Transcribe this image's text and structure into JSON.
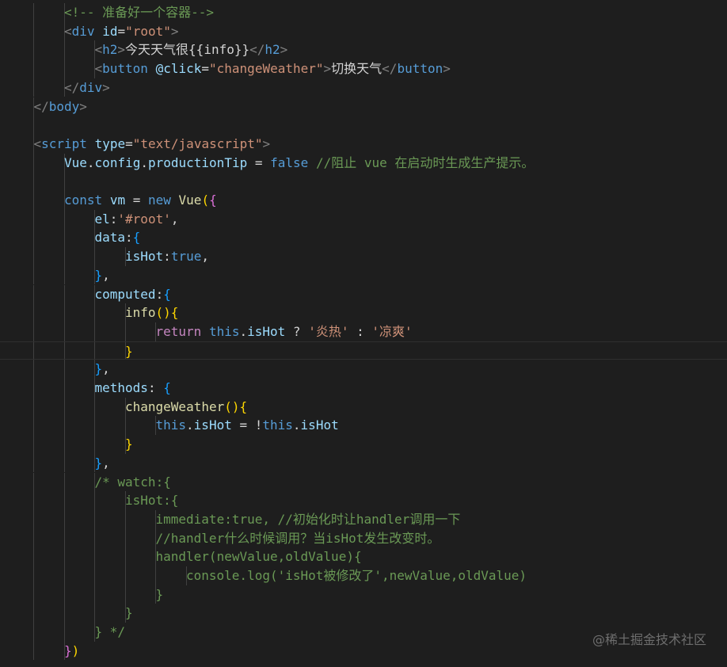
{
  "lines": [
    {
      "indent": 2,
      "guides": 2,
      "tokens": [
        {
          "c": "cmt",
          "t": "<!-- 准备好一个容器-->"
        }
      ]
    },
    {
      "indent": 2,
      "guides": 2,
      "tokens": [
        {
          "c": "punct",
          "t": "<"
        },
        {
          "c": "tag",
          "t": "div"
        },
        {
          "c": "text",
          "t": " "
        },
        {
          "c": "attr",
          "t": "id"
        },
        {
          "c": "text",
          "t": "="
        },
        {
          "c": "str",
          "t": "\"root\""
        },
        {
          "c": "punct",
          "t": ">"
        }
      ]
    },
    {
      "indent": 3,
      "guides": 3,
      "tokens": [
        {
          "c": "punct",
          "t": "<"
        },
        {
          "c": "tag",
          "t": "h2"
        },
        {
          "c": "punct",
          "t": ">"
        },
        {
          "c": "text",
          "t": "今天天气很{{info}}"
        },
        {
          "c": "punct",
          "t": "</"
        },
        {
          "c": "tag",
          "t": "h2"
        },
        {
          "c": "punct",
          "t": ">"
        }
      ]
    },
    {
      "indent": 3,
      "guides": 3,
      "tokens": [
        {
          "c": "punct",
          "t": "<"
        },
        {
          "c": "tag",
          "t": "button"
        },
        {
          "c": "text",
          "t": " "
        },
        {
          "c": "attr",
          "t": "@click"
        },
        {
          "c": "text",
          "t": "="
        },
        {
          "c": "str",
          "t": "\"changeWeather\""
        },
        {
          "c": "punct",
          "t": ">"
        },
        {
          "c": "text",
          "t": "切换天气"
        },
        {
          "c": "punct",
          "t": "</"
        },
        {
          "c": "tag",
          "t": "button"
        },
        {
          "c": "punct",
          "t": ">"
        }
      ]
    },
    {
      "indent": 2,
      "guides": 2,
      "tokens": [
        {
          "c": "punct",
          "t": "</"
        },
        {
          "c": "tag",
          "t": "div"
        },
        {
          "c": "punct",
          "t": ">"
        }
      ]
    },
    {
      "indent": 1,
      "guides": 1,
      "tokens": [
        {
          "c": "punct",
          "t": "</"
        },
        {
          "c": "tag",
          "t": "body"
        },
        {
          "c": "punct",
          "t": ">"
        }
      ]
    },
    {
      "indent": 0,
      "guides": 1,
      "tokens": []
    },
    {
      "indent": 1,
      "guides": 1,
      "tokens": [
        {
          "c": "punct",
          "t": "<"
        },
        {
          "c": "tag",
          "t": "script"
        },
        {
          "c": "text",
          "t": " "
        },
        {
          "c": "attr",
          "t": "type"
        },
        {
          "c": "text",
          "t": "="
        },
        {
          "c": "str",
          "t": "\"text/javascript\""
        },
        {
          "c": "punct",
          "t": ">"
        }
      ]
    },
    {
      "indent": 2,
      "guides": 2,
      "tokens": [
        {
          "c": "attr",
          "t": "Vue"
        },
        {
          "c": "text",
          "t": "."
        },
        {
          "c": "attr",
          "t": "config"
        },
        {
          "c": "text",
          "t": "."
        },
        {
          "c": "attr",
          "t": "productionTip"
        },
        {
          "c": "text",
          "t": " = "
        },
        {
          "c": "bool",
          "t": "false"
        },
        {
          "c": "text",
          "t": " "
        },
        {
          "c": "cmt",
          "t": "//阻止 vue 在启动时生成生产提示。"
        }
      ]
    },
    {
      "indent": 0,
      "guides": 2,
      "tokens": []
    },
    {
      "indent": 2,
      "guides": 2,
      "tokens": [
        {
          "c": "kw",
          "t": "const"
        },
        {
          "c": "text",
          "t": " "
        },
        {
          "c": "attr",
          "t": "vm"
        },
        {
          "c": "text",
          "t": " = "
        },
        {
          "c": "kw",
          "t": "new"
        },
        {
          "c": "text",
          "t": " "
        },
        {
          "c": "fn",
          "t": "Vue"
        },
        {
          "c": "b1",
          "t": "("
        },
        {
          "c": "b2",
          "t": "{"
        }
      ]
    },
    {
      "indent": 3,
      "guides": 3,
      "tokens": [
        {
          "c": "attr",
          "t": "el"
        },
        {
          "c": "text",
          "t": ":"
        },
        {
          "c": "str",
          "t": "'#root'"
        },
        {
          "c": "text",
          "t": ","
        }
      ]
    },
    {
      "indent": 3,
      "guides": 3,
      "tokens": [
        {
          "c": "attr",
          "t": "data"
        },
        {
          "c": "text",
          "t": ":"
        },
        {
          "c": "b3",
          "t": "{"
        }
      ]
    },
    {
      "indent": 4,
      "guides": 4,
      "tokens": [
        {
          "c": "attr",
          "t": "isHot"
        },
        {
          "c": "text",
          "t": ":"
        },
        {
          "c": "bool",
          "t": "true"
        },
        {
          "c": "text",
          "t": ","
        }
      ]
    },
    {
      "indent": 3,
      "guides": 3,
      "tokens": [
        {
          "c": "b3",
          "t": "}"
        },
        {
          "c": "text",
          "t": ","
        }
      ]
    },
    {
      "indent": 3,
      "guides": 3,
      "tokens": [
        {
          "c": "attr",
          "t": "computed"
        },
        {
          "c": "text",
          "t": ":"
        },
        {
          "c": "b3",
          "t": "{"
        }
      ]
    },
    {
      "indent": 4,
      "guides": 4,
      "tokens": [
        {
          "c": "fn",
          "t": "info"
        },
        {
          "c": "b1",
          "t": "()"
        },
        {
          "c": "b1",
          "t": "{"
        }
      ]
    },
    {
      "indent": 5,
      "guides": 5,
      "tokens": [
        {
          "c": "ctl",
          "t": "return"
        },
        {
          "c": "text",
          "t": " "
        },
        {
          "c": "kw",
          "t": "this"
        },
        {
          "c": "text",
          "t": "."
        },
        {
          "c": "attr",
          "t": "isHot"
        },
        {
          "c": "text",
          "t": " ? "
        },
        {
          "c": "str",
          "t": "'炎热'"
        },
        {
          "c": "text",
          "t": " : "
        },
        {
          "c": "str",
          "t": "'凉爽'"
        }
      ]
    },
    {
      "indent": 4,
      "guides": 4,
      "current": true,
      "tokens": [
        {
          "c": "b1",
          "t": "}"
        }
      ]
    },
    {
      "indent": 3,
      "guides": 3,
      "tokens": [
        {
          "c": "b3",
          "t": "}"
        },
        {
          "c": "text",
          "t": ","
        }
      ]
    },
    {
      "indent": 3,
      "guides": 3,
      "tokens": [
        {
          "c": "attr",
          "t": "methods"
        },
        {
          "c": "text",
          "t": ": "
        },
        {
          "c": "b3",
          "t": "{"
        }
      ]
    },
    {
      "indent": 4,
      "guides": 4,
      "tokens": [
        {
          "c": "fn",
          "t": "changeWeather"
        },
        {
          "c": "b1",
          "t": "()"
        },
        {
          "c": "b1",
          "t": "{"
        }
      ]
    },
    {
      "indent": 5,
      "guides": 5,
      "tokens": [
        {
          "c": "kw",
          "t": "this"
        },
        {
          "c": "text",
          "t": "."
        },
        {
          "c": "attr",
          "t": "isHot"
        },
        {
          "c": "text",
          "t": " = !"
        },
        {
          "c": "kw",
          "t": "this"
        },
        {
          "c": "text",
          "t": "."
        },
        {
          "c": "attr",
          "t": "isHot"
        }
      ]
    },
    {
      "indent": 4,
      "guides": 4,
      "tokens": [
        {
          "c": "b1",
          "t": "}"
        }
      ]
    },
    {
      "indent": 3,
      "guides": 3,
      "tokens": [
        {
          "c": "b3",
          "t": "}"
        },
        {
          "c": "text",
          "t": ","
        }
      ]
    },
    {
      "indent": 3,
      "guides": 3,
      "tokens": [
        {
          "c": "cmt",
          "t": "/* watch:{"
        }
      ]
    },
    {
      "indent": 4,
      "guides": 4,
      "tokens": [
        {
          "c": "cmt",
          "t": "isHot:{"
        }
      ]
    },
    {
      "indent": 5,
      "guides": 5,
      "tokens": [
        {
          "c": "cmt",
          "t": "immediate:true, //初始化时让handler调用一下"
        }
      ]
    },
    {
      "indent": 5,
      "guides": 5,
      "tokens": [
        {
          "c": "cmt",
          "t": "//handler什么时候调用？当isHot发生改变时。"
        }
      ]
    },
    {
      "indent": 5,
      "guides": 5,
      "tokens": [
        {
          "c": "cmt",
          "t": "handler(newValue,oldValue){"
        }
      ]
    },
    {
      "indent": 6,
      "guides": 6,
      "tokens": [
        {
          "c": "cmt",
          "t": "console.log('isHot被修改了',newValue,oldValue)"
        }
      ]
    },
    {
      "indent": 5,
      "guides": 5,
      "tokens": [
        {
          "c": "cmt",
          "t": "}"
        }
      ]
    },
    {
      "indent": 4,
      "guides": 4,
      "tokens": [
        {
          "c": "cmt",
          "t": "}"
        }
      ]
    },
    {
      "indent": 3,
      "guides": 3,
      "tokens": [
        {
          "c": "cmt",
          "t": "} */"
        }
      ]
    },
    {
      "indent": 2,
      "guides": 2,
      "tokens": [
        {
          "c": "b2",
          "t": "}"
        },
        {
          "c": "b1",
          "t": ")"
        }
      ]
    }
  ],
  "watermark": "@稀土掘金技术社区"
}
